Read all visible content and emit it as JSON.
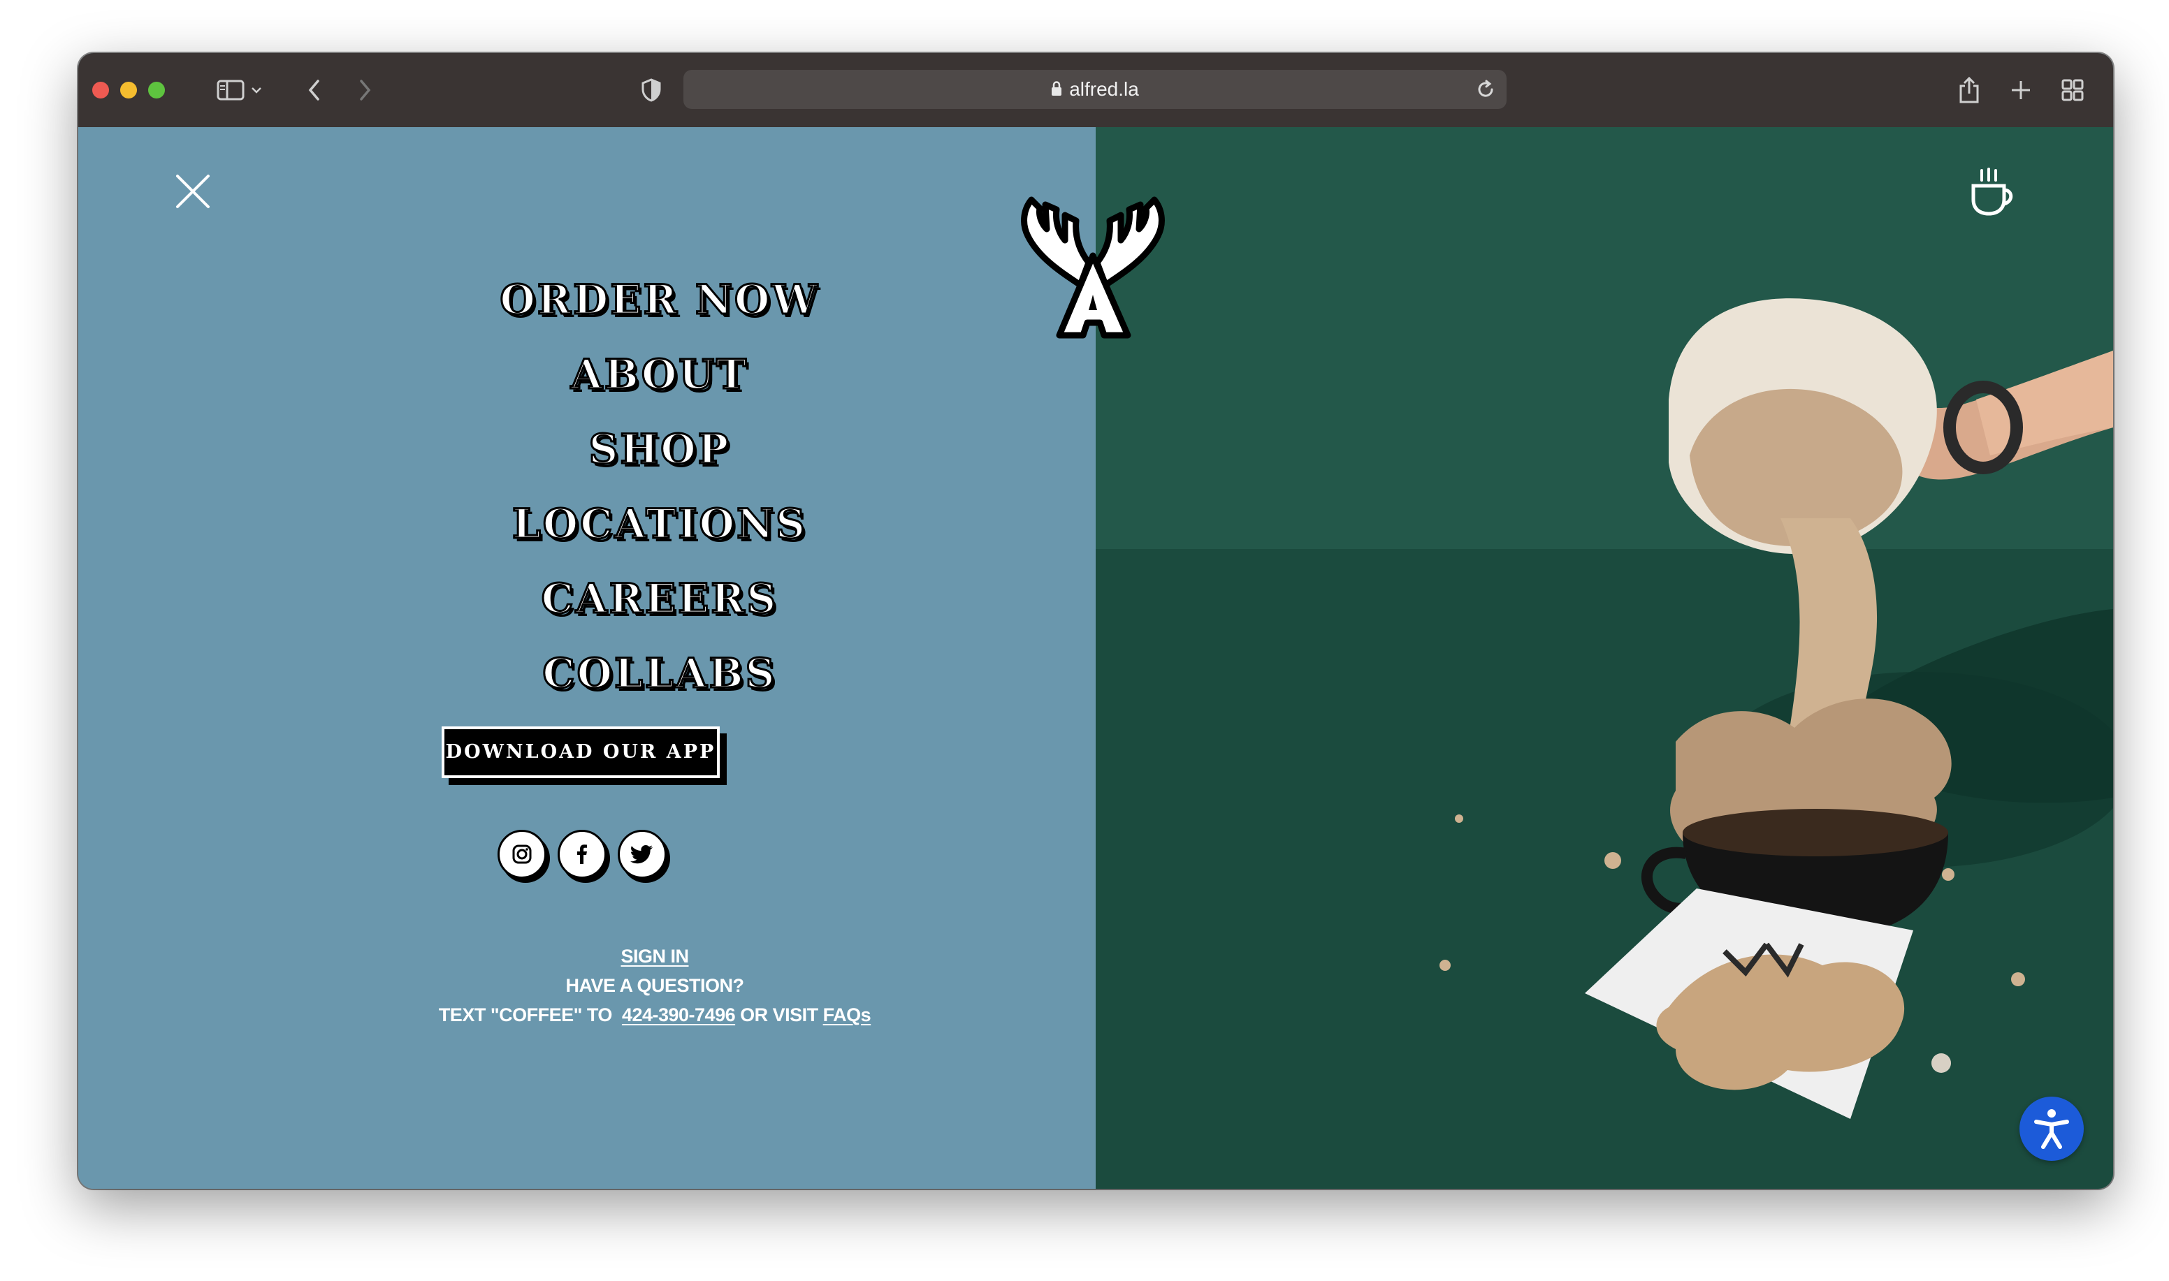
{
  "browser": {
    "url": "alfred.la",
    "icons": [
      "sidebar-icon",
      "chevron-down-icon",
      "back-icon",
      "forward-icon",
      "shield-icon",
      "lock-icon",
      "reload-icon",
      "share-icon",
      "new-tab-icon",
      "tab-overview-icon"
    ],
    "traffic_lights": {
      "close": "#ee5a52",
      "minimize": "#f5bd2f",
      "maximize": "#5ec33f"
    }
  },
  "header": {
    "close_icon": "close-icon",
    "logo": "alfred-antler-logo",
    "cart_icon": "coffee-cup-cart-icon"
  },
  "menu": {
    "items": [
      {
        "label": "ORDER NOW"
      },
      {
        "label": "ABOUT"
      },
      {
        "label": "SHOP"
      },
      {
        "label": "LOCATIONS"
      },
      {
        "label": "CAREERS"
      },
      {
        "label": "COLLABS"
      }
    ],
    "app_button": "DOWNLOAD OUR APP"
  },
  "social": [
    "instagram-icon",
    "facebook-icon",
    "twitter-icon"
  ],
  "footer": {
    "sign_in": "SIGN IN",
    "question": "HAVE A QUESTION?",
    "text_prefix": "TEXT \"COFFEE\" TO",
    "phone": "424-390-7496",
    "or_visit": "OR VISIT",
    "faqs": "FAQs"
  },
  "hero": {
    "description_icon": "coffee-pour-photo"
  },
  "accessibility": {
    "icon": "accessibility-icon"
  },
  "colors": {
    "left_panel": "#6a97ad",
    "right_panel": "#23584a",
    "toolbar": "#3a3433",
    "accessibility": "#1c5bd9"
  }
}
